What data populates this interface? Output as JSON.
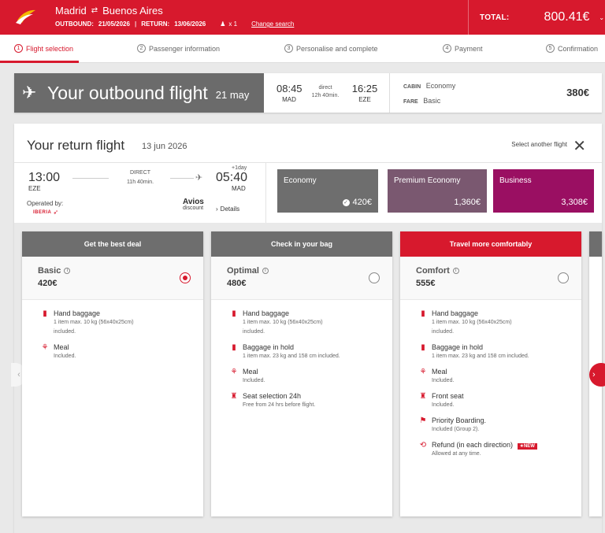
{
  "header": {
    "origin": "Madrid",
    "destination": "Buenos Aires",
    "route_icon": "swap-icon",
    "outbound_label": "OUTBOUND:",
    "outbound_date": "21/05/2026",
    "return_label": "RETURN:",
    "return_date": "13/06/2026",
    "passengers": "x 1",
    "change_search": "Change search",
    "total_label": "TOTAL:",
    "total_amount": "800.41€",
    "brand_color": "#d7192d"
  },
  "steps": [
    {
      "num": "1",
      "label": "Flight selection"
    },
    {
      "num": "2",
      "label": "Passenger information"
    },
    {
      "num": "3",
      "label": "Personalise and complete"
    },
    {
      "num": "4",
      "label": "Payment"
    },
    {
      "num": "5",
      "label": "Confirmation"
    }
  ],
  "outbound": {
    "title": "Your outbound flight",
    "date": "21 may",
    "dep_time": "08:45",
    "dep_code": "MAD",
    "stops": "direct",
    "duration": "12h 40min.",
    "arr_time": "16:25",
    "arr_code": "EZE",
    "cabin_key": "CABIN",
    "cabin": "Economy",
    "fare_key": "FARE",
    "fare": "Basic",
    "price": "380€"
  },
  "return": {
    "title": "Your return flight",
    "date": "13 jun 2026",
    "select_another": "Select another flight",
    "dep_time": "13:00",
    "dep_code": "EZE",
    "stops": "DIRECT",
    "duration": "11h 40min.",
    "plus_day": "+1day",
    "arr_time": "05:40",
    "arr_code": "MAD",
    "operated_by": "Operated by:",
    "operator_logo_text": "IBERIA",
    "avios_title": "Avios",
    "avios_sub": "discount",
    "details": "Details"
  },
  "cabins": [
    {
      "name": "Economy",
      "price": "420€",
      "color": "#6e6e6e"
    },
    {
      "name": "Premium Economy",
      "price": "1,360€",
      "color": "#7a5870"
    },
    {
      "name": "Business",
      "price": "3,308€",
      "color": "#9a0f62"
    }
  ],
  "fares": [
    {
      "header": "Get the best deal",
      "name": "Basic",
      "price": "420€",
      "selected": true,
      "features": [
        {
          "icon": "suitcase-icon",
          "title": "Hand baggage",
          "desc1": "1 item max. 10 kg (56x40x25cm)",
          "desc2": "included."
        },
        {
          "icon": "meal-icon",
          "title": "Meal",
          "desc1": "Included.",
          "desc2": ""
        }
      ]
    },
    {
      "header": "Check in your bag",
      "name": "Optimal",
      "price": "480€",
      "selected": false,
      "features": [
        {
          "icon": "suitcase-icon",
          "title": "Hand baggage",
          "desc1": "1 item max. 10 kg (56x40x25cm)",
          "desc2": "included."
        },
        {
          "icon": "baggage-icon",
          "title": "Baggage in hold",
          "desc1": "1 item max. 23 kg and 158 cm included.",
          "desc2": ""
        },
        {
          "icon": "meal-icon",
          "title": "Meal",
          "desc1": "Included.",
          "desc2": ""
        },
        {
          "icon": "seat-icon",
          "title": "Seat selection 24h",
          "desc1": "Free from 24 hrs before flight.",
          "desc2": ""
        }
      ]
    },
    {
      "header": "Travel more comfortably",
      "name": "Comfort",
      "price": "555€",
      "selected": false,
      "features": [
        {
          "icon": "suitcase-icon",
          "title": "Hand baggage",
          "desc1": "1 item max. 10 kg (56x40x25cm)",
          "desc2": "included."
        },
        {
          "icon": "baggage-icon",
          "title": "Baggage in hold",
          "desc1": "1 item max. 23 kg and 158 cm included.",
          "desc2": ""
        },
        {
          "icon": "meal-icon",
          "title": "Meal",
          "desc1": "Included.",
          "desc2": ""
        },
        {
          "icon": "front-seat-icon",
          "title": "Front seat",
          "desc1": "Included.",
          "desc2": ""
        },
        {
          "icon": "priority-boarding-icon",
          "title": "Priority Boarding.",
          "desc1": "Included (Group 2).",
          "desc2": ""
        },
        {
          "icon": "refund-icon",
          "title": "Refund (in each direction)",
          "badge": "NEW",
          "desc1": "Allowed at any time.",
          "desc2": ""
        }
      ]
    }
  ]
}
